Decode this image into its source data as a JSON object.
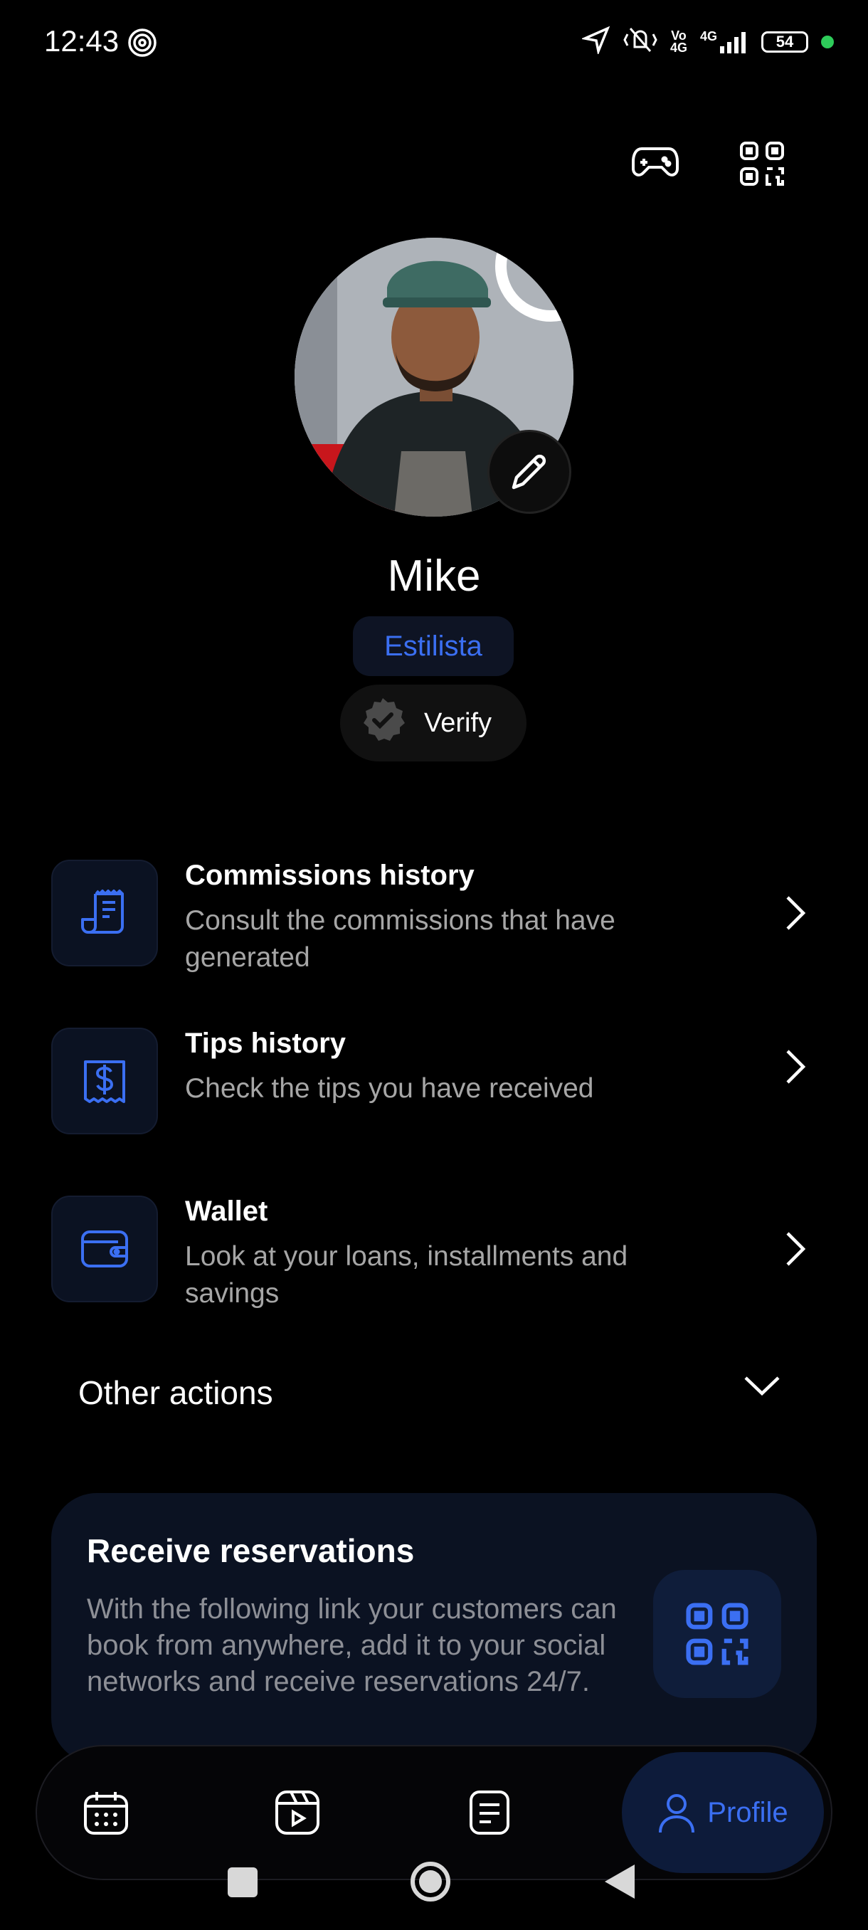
{
  "status_bar": {
    "time": "12:43",
    "net_top": "Vo",
    "net_bottom": "4G",
    "signal_label": "4G",
    "battery": "54"
  },
  "top_actions": {
    "game_icon": "gamepad-icon",
    "qr_icon": "qr-code-icon"
  },
  "profile": {
    "name": "Mike",
    "role": "Estilista",
    "verify_label": "Verify"
  },
  "menu": [
    {
      "title": "Commissions history",
      "description": "Consult the commissions that have generated",
      "icon": "receipt-icon"
    },
    {
      "title": "Tips history",
      "description": "Check the tips you have received",
      "icon": "dollar-bill-icon"
    },
    {
      "title": "Wallet",
      "description": "Look at your loans, installments and savings",
      "icon": "wallet-icon"
    }
  ],
  "other_actions": {
    "label": "Other actions"
  },
  "reservations": {
    "title": "Receive reservations",
    "description": "With the following link your customers can book from anywhere, add it to your social networks and receive reservations 24/7."
  },
  "bottom_nav": {
    "items": [
      "calendar-icon",
      "video-icon",
      "document-icon"
    ],
    "active_label": "Profile"
  },
  "colors": {
    "accent": "#3b6ff2",
    "card_bg": "#0b1222",
    "background": "#000000"
  }
}
